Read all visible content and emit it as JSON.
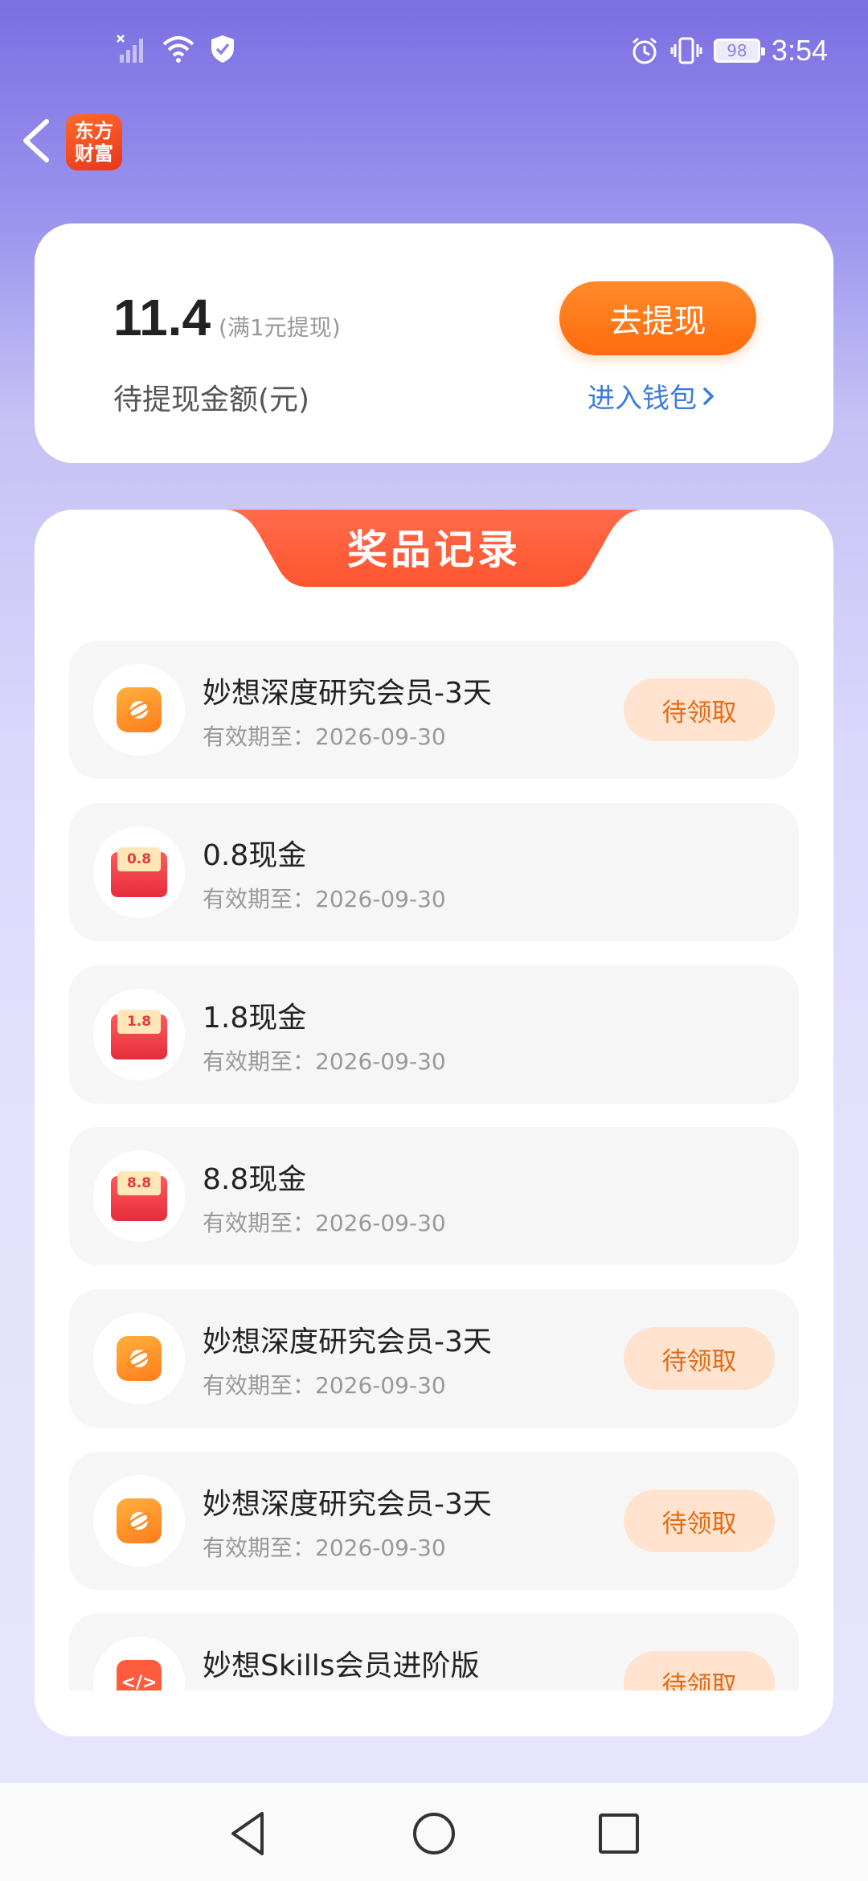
{
  "status_bar": {
    "time": "3:54",
    "battery": "98",
    "icons": [
      "no-signal-icon",
      "wifi-icon",
      "shield-icon",
      "alarm-icon",
      "vibrate-icon",
      "battery-icon"
    ]
  },
  "header": {
    "back_icon": "back-arrow-icon",
    "logo_line1": "东方",
    "logo_line2": "财富"
  },
  "wallet": {
    "amount": "11.4",
    "amount_note": "(满1元提现)",
    "amount_label": "待提现金额(元)",
    "withdraw_label": "去提现",
    "wallet_link": "进入钱包",
    "accent_color": "#ff7a1a",
    "link_color": "#3b7be0"
  },
  "prizes": {
    "title": "奖品记录",
    "items": [
      {
        "icon": "app-icon",
        "title": "妙想深度研究会员-3天",
        "subtitle": "有效期至：2026-09-30",
        "button": "待领取"
      },
      {
        "icon": "red-envelope-icon",
        "badge": "0.8",
        "title": "0.8现金",
        "subtitle": "有效期至：2026-09-30"
      },
      {
        "icon": "red-envelope-icon",
        "badge": "1.8",
        "title": "1.8现金",
        "subtitle": "有效期至：2026-09-30"
      },
      {
        "icon": "red-envelope-icon",
        "badge": "8.8",
        "title": "8.8现金",
        "subtitle": "有效期至：2026-09-30"
      },
      {
        "icon": "app-icon",
        "title": "妙想深度研究会员-3天",
        "subtitle": "有效期至：2026-09-30",
        "button": "待领取"
      },
      {
        "icon": "app-icon",
        "title": "妙想深度研究会员-3天",
        "subtitle": "有效期至：2026-09-30",
        "button": "待领取"
      },
      {
        "icon": "code-icon",
        "title": "妙想Skills会员进阶版",
        "button": "待领取"
      }
    ]
  },
  "nav_bar": {
    "icons": [
      "nav-back-icon",
      "nav-home-icon",
      "nav-recents-icon"
    ]
  }
}
